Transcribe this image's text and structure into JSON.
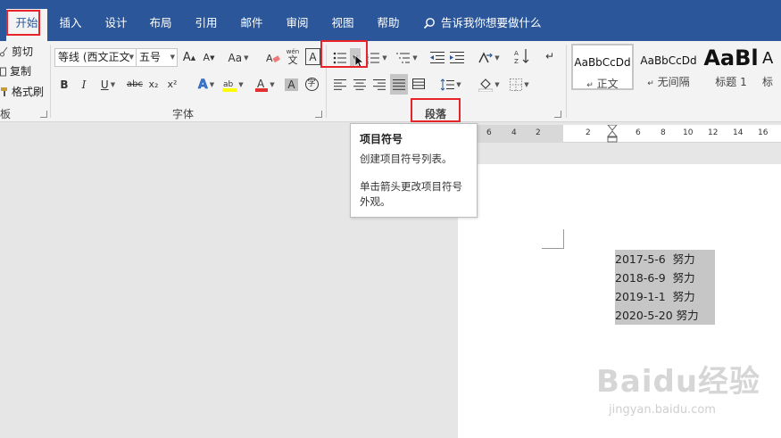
{
  "tabs": [
    {
      "label": "开始",
      "active": true
    },
    {
      "label": "插入"
    },
    {
      "label": "设计"
    },
    {
      "label": "布局"
    },
    {
      "label": "引用"
    },
    {
      "label": "邮件"
    },
    {
      "label": "审阅"
    },
    {
      "label": "视图"
    },
    {
      "label": "帮助"
    }
  ],
  "tell_me": "告诉我你想要做什么",
  "clipboard": {
    "cut": "剪切",
    "copy": "复制",
    "format_painter": "格式刷",
    "group_label": "板"
  },
  "font": {
    "name": "等线 (西文正文",
    "size": "五号",
    "change_case": "Aa",
    "bold": "B",
    "italic": "I",
    "underline": "U",
    "strike": "abc",
    "sub": "x₂",
    "sup": "x²",
    "group_label": "字体"
  },
  "paragraph": {
    "group_label": "段落"
  },
  "styles": [
    {
      "sample": "AaBbCcDd",
      "name": "正文"
    },
    {
      "sample": "AaBbCcDd",
      "name": "无间隔"
    },
    {
      "sample": "AaBl",
      "name": "标题 1"
    },
    {
      "sample": "A",
      "name": "标"
    }
  ],
  "tooltip": {
    "title": "项目符号",
    "description": "创建项目符号列表。",
    "hint": "单击箭头更改项目符号外观。"
  },
  "ruler_numbers": [
    "6",
    "4",
    "2",
    "2",
    "6",
    "8",
    "10",
    "12",
    "14",
    "16"
  ],
  "document_lines": [
    "2017-5-6  努力",
    "2018-6-9  努力",
    "2019-1-1  努力",
    "2020-5-20 努力"
  ],
  "watermark": {
    "logo": "Baidu经验",
    "url": "jingyan.baidu.com"
  },
  "colors": {
    "ribbon_blue": "#2b579a",
    "highlight_red": "#e8232a"
  }
}
